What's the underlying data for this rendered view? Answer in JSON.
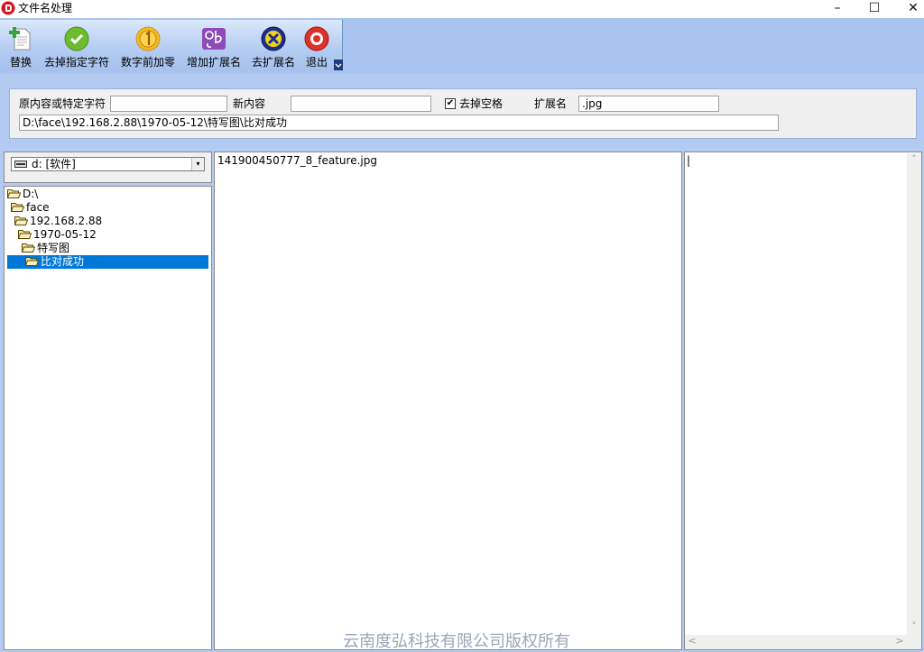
{
  "window": {
    "title": "文件名处理",
    "minimize_glyph": "–",
    "maximize_glyph": "☐",
    "close_glyph": "✕",
    "app_icon": "app-logo-icon"
  },
  "toolbar": {
    "buttons": [
      {
        "label": "替换",
        "icon": "document-add-icon"
      },
      {
        "label": "去掉指定字符",
        "icon": "green-check-icon"
      },
      {
        "label": "数字前加零",
        "icon": "gold-coin-one-icon"
      },
      {
        "label": "增加扩展名",
        "icon": "abc-letters-icon"
      },
      {
        "label": "去扩展名",
        "icon": "blue-x-icon"
      },
      {
        "label": "退出",
        "icon": "red-exit-icon"
      }
    ]
  },
  "form": {
    "original_label": "原内容或特定字符",
    "original_value": "",
    "new_label": "新内容",
    "new_value": "",
    "remove_spaces_label": "去掉空格",
    "remove_spaces_checked": true,
    "check_glyph": "✔",
    "extension_label": "扩展名",
    "extension_value": ".jpg",
    "path_value": "D:\\face\\192.168.2.88\\1970-05-12\\特写图\\比对成功"
  },
  "drive": {
    "selected": "d: [软件]",
    "arrow_glyph": "▾"
  },
  "tree": {
    "items": [
      "D:\\",
      "face",
      "192.168.2.88",
      "1970-05-12",
      "特写图",
      "比对成功"
    ],
    "selected_index": 5
  },
  "files": {
    "items": [
      "141900450777_8_feature.jpg"
    ]
  },
  "result": {
    "text": "|"
  },
  "scrollbars": {
    "up": "˄",
    "down": "˅",
    "left": "<",
    "right": ">"
  },
  "watermark": "云南度弘科技有限公司版权所有",
  "colors": {
    "toolbar_band": "#a9c4ee",
    "panel_band": "#b3cbf1",
    "selection": "#0078d7"
  }
}
